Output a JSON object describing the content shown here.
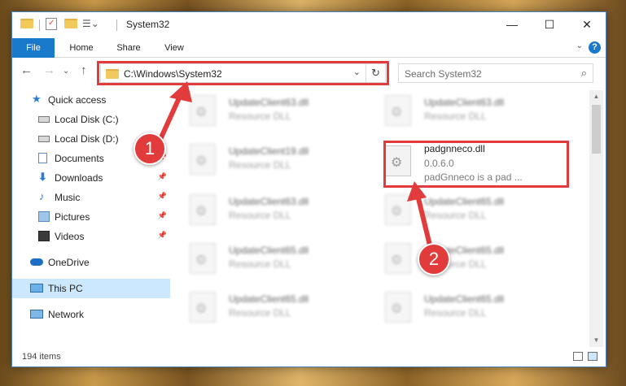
{
  "window": {
    "title": "System32",
    "minimize": "—",
    "maximize": "☐",
    "close": "✕"
  },
  "ribbon": {
    "tabs": [
      "File",
      "Home",
      "Share",
      "View"
    ],
    "help": "?",
    "expand": "⌄"
  },
  "navigation": {
    "back": "←",
    "forward": "→",
    "recent": "⌄",
    "up": "↑",
    "address": "C:\\Windows\\System32",
    "address_dropdown": "⌄",
    "refresh": "↻",
    "search_placeholder": "Search System32",
    "search_icon": "⌕"
  },
  "sidebar": {
    "items": [
      {
        "label": "Quick access",
        "icon": "star-icon"
      },
      {
        "label": "Local Disk (C:)",
        "icon": "drive-icon"
      },
      {
        "label": "Local Disk (D:)",
        "icon": "drive-icon"
      },
      {
        "label": "Documents",
        "icon": "documents-icon",
        "pinned": true
      },
      {
        "label": "Downloads",
        "icon": "download-icon",
        "pinned": true
      },
      {
        "label": "Music",
        "icon": "music-icon",
        "pinned": true
      },
      {
        "label": "Pictures",
        "icon": "pictures-icon",
        "pinned": true
      },
      {
        "label": "Videos",
        "icon": "videos-icon",
        "pinned": true
      },
      {
        "label": "OneDrive",
        "icon": "cloud-icon"
      },
      {
        "label": "This PC",
        "icon": "computer-icon",
        "selected": true
      },
      {
        "label": "Network",
        "icon": "network-icon"
      }
    ]
  },
  "files": [
    {
      "name": "UpdateClient63.dll",
      "type": "Resource DLL"
    },
    {
      "name": "UpdateClient63.dll",
      "type": "Resource DLL"
    },
    {
      "name": "UpdateClient19.dll",
      "type": "Resource DLL"
    },
    {
      "name": "padgnneco.dll",
      "version": "0.0.6.0",
      "description": "padGnneco is a pad ..."
    },
    {
      "name": "UpdateClient63.dll",
      "type": "Resource DLL"
    },
    {
      "name": "UpdateClient65.dll",
      "type": "Resource DLL"
    },
    {
      "name": "UpdateClient65.dll",
      "type": "Resource DLL"
    },
    {
      "name": "UpdateClient65.dll",
      "type": "Resource DLL"
    },
    {
      "name": "UpdateClient65.dll",
      "type": "Resource DLL"
    },
    {
      "name": "UpdateClient65.dll",
      "type": "Resource DLL"
    }
  ],
  "status": {
    "item_count": "194 items"
  },
  "annotations": {
    "step1": "1",
    "step2": "2",
    "color": "#e23b3b"
  }
}
